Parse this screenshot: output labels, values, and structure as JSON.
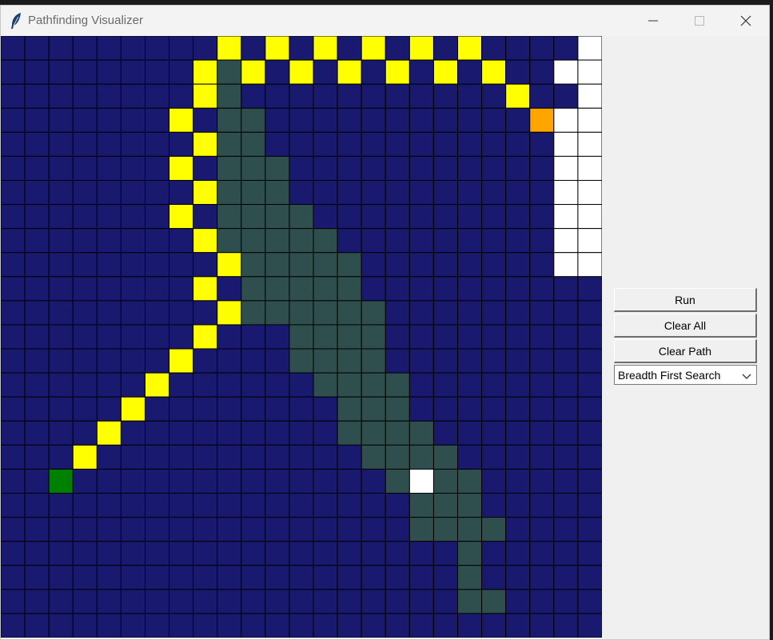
{
  "window": {
    "title": "Pathfinding Visualizer",
    "icon": "feather-icon",
    "controls": [
      "minimize-icon",
      "maximize-icon",
      "close-icon"
    ]
  },
  "controls": {
    "run_label": "Run",
    "clear_all_label": "Clear All",
    "clear_path_label": "Clear Path",
    "algorithm_selected": "Breadth First Search"
  },
  "grid": {
    "rows": 25,
    "cols": 25,
    "colors": {
      "empty": "#191970",
      "wall": "#2f4f4f",
      "path": "#ffff00",
      "visited": "#ffffff",
      "start": "#008000",
      "end": "#ffa500",
      "line": "#000000"
    },
    "walls": [
      [
        1,
        9
      ],
      [
        2,
        9
      ],
      [
        3,
        9
      ],
      [
        3,
        10
      ],
      [
        4,
        9
      ],
      [
        4,
        10
      ],
      [
        5,
        9
      ],
      [
        5,
        10
      ],
      [
        5,
        11
      ],
      [
        6,
        9
      ],
      [
        6,
        10
      ],
      [
        6,
        11
      ],
      [
        7,
        9
      ],
      [
        7,
        10
      ],
      [
        7,
        11
      ],
      [
        7,
        12
      ],
      [
        8,
        9
      ],
      [
        8,
        10
      ],
      [
        8,
        11
      ],
      [
        8,
        12
      ],
      [
        8,
        13
      ],
      [
        9,
        10
      ],
      [
        9,
        11
      ],
      [
        9,
        12
      ],
      [
        9,
        13
      ],
      [
        9,
        14
      ],
      [
        10,
        10
      ],
      [
        10,
        11
      ],
      [
        10,
        12
      ],
      [
        10,
        13
      ],
      [
        10,
        14
      ],
      [
        11,
        10
      ],
      [
        11,
        11
      ],
      [
        11,
        12
      ],
      [
        11,
        13
      ],
      [
        11,
        14
      ],
      [
        11,
        15
      ],
      [
        12,
        12
      ],
      [
        12,
        13
      ],
      [
        12,
        14
      ],
      [
        12,
        15
      ],
      [
        13,
        12
      ],
      [
        13,
        13
      ],
      [
        13,
        14
      ],
      [
        13,
        15
      ],
      [
        14,
        13
      ],
      [
        14,
        14
      ],
      [
        14,
        15
      ],
      [
        14,
        16
      ],
      [
        15,
        14
      ],
      [
        15,
        15
      ],
      [
        15,
        16
      ],
      [
        16,
        14
      ],
      [
        16,
        15
      ],
      [
        16,
        16
      ],
      [
        16,
        17
      ],
      [
        17,
        15
      ],
      [
        17,
        16
      ],
      [
        17,
        17
      ],
      [
        17,
        18
      ],
      [
        18,
        16
      ],
      [
        18,
        18
      ],
      [
        18,
        19
      ],
      [
        19,
        17
      ],
      [
        19,
        18
      ],
      [
        19,
        19
      ],
      [
        20,
        17
      ],
      [
        20,
        18
      ],
      [
        20,
        19
      ],
      [
        20,
        20
      ],
      [
        21,
        19
      ],
      [
        22,
        19
      ],
      [
        23,
        19
      ],
      [
        23,
        20
      ]
    ],
    "path": [
      [
        0,
        9
      ],
      [
        0,
        11
      ],
      [
        0,
        13
      ],
      [
        0,
        15
      ],
      [
        0,
        17
      ],
      [
        0,
        19
      ],
      [
        1,
        8
      ],
      [
        1,
        10
      ],
      [
        1,
        12
      ],
      [
        1,
        14
      ],
      [
        1,
        16
      ],
      [
        1,
        18
      ],
      [
        1,
        20
      ],
      [
        2,
        8
      ],
      [
        2,
        21
      ],
      [
        3,
        7
      ],
      [
        4,
        8
      ],
      [
        5,
        7
      ],
      [
        6,
        8
      ],
      [
        7,
        7
      ],
      [
        8,
        8
      ],
      [
        9,
        9
      ],
      [
        10,
        8
      ],
      [
        11,
        9
      ],
      [
        12,
        8
      ],
      [
        13,
        7
      ],
      [
        14,
        6
      ],
      [
        15,
        5
      ],
      [
        16,
        4
      ],
      [
        17,
        3
      ]
    ],
    "visited": [
      [
        0,
        24
      ],
      [
        1,
        23
      ],
      [
        1,
        24
      ],
      [
        2,
        24
      ],
      [
        3,
        23
      ],
      [
        3,
        24
      ],
      [
        4,
        23
      ],
      [
        4,
        24
      ],
      [
        5,
        23
      ],
      [
        5,
        24
      ],
      [
        6,
        23
      ],
      [
        6,
        24
      ],
      [
        7,
        23
      ],
      [
        7,
        24
      ],
      [
        8,
        23
      ],
      [
        8,
        24
      ],
      [
        9,
        23
      ],
      [
        9,
        24
      ],
      [
        18,
        17
      ]
    ],
    "start": [
      18,
      2
    ],
    "end": [
      3,
      22
    ]
  }
}
